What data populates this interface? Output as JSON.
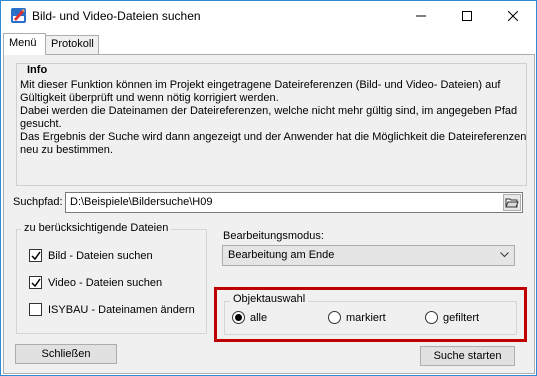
{
  "window": {
    "title": "Bild- und Video-Dateien suchen",
    "accent_color": "#2d8bd6",
    "icon": "app-pencil-icon"
  },
  "tabs": [
    {
      "label": "Menü",
      "active": true
    },
    {
      "label": "Protokoll",
      "active": false
    }
  ],
  "info": {
    "title": "Info",
    "lines": [
      "Mit dieser Funktion können im Projekt eingetragene Dateireferenzen (Bild- und Video- Dateien) auf",
      "Gültigkeit überprüft und wenn nötig korrigiert werden.",
      "Dabei werden die Dateinamen der Dateireferenzen, welche nicht mehr gültig sind, im angegeben Pfad",
      "gesucht.",
      "Das Ergebnis der Suche wird dann angezeigt und der Anwender hat die Möglichkeit die Dateireferenzen",
      "neu zu bestimmen."
    ]
  },
  "search_path": {
    "label": "Suchpfad:",
    "value": "D:\\Beispiele\\Bildersuche\\H09",
    "browse_icon": "folder-open-icon"
  },
  "files_group": {
    "title": "zu berücksichtigende Dateien",
    "options": [
      {
        "label": "Bild - Dateien suchen",
        "checked": true
      },
      {
        "label": "Video - Dateien suchen",
        "checked": true
      },
      {
        "label": "ISYBAU - Dateinamen ändern",
        "checked": false
      }
    ]
  },
  "mode": {
    "label": "Bearbeitungsmodus:",
    "selected": "Bearbeitung am Ende"
  },
  "object_selection": {
    "title": "Objektauswahl",
    "highlight_color": "#c00000",
    "options": [
      {
        "label": "alle",
        "selected": true
      },
      {
        "label": "markiert",
        "selected": false
      },
      {
        "label": "gefiltert",
        "selected": false
      }
    ]
  },
  "buttons": {
    "close_label": "Schließen",
    "search_label": "Suche starten"
  }
}
